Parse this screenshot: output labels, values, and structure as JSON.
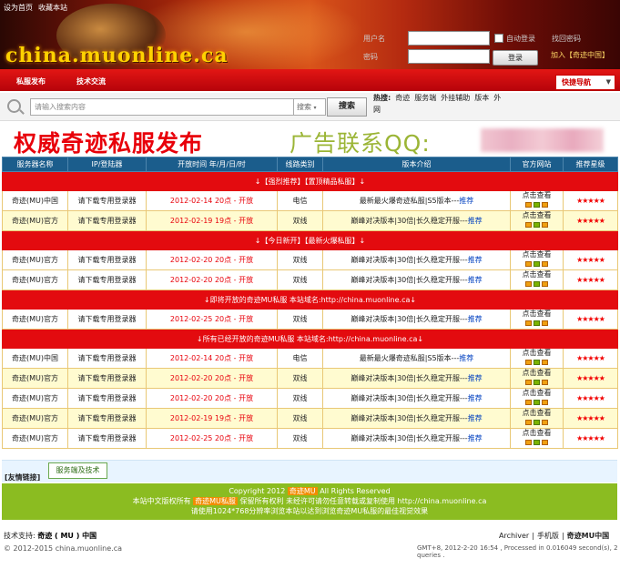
{
  "top_links": [
    "设为首页",
    "收藏本站"
  ],
  "site_logo": "china.muonline.ca",
  "login": {
    "username_label": "用户名",
    "password_label": "密码",
    "auto_login_label": "自动登录",
    "find_password_label": "找回密码",
    "login_button": "登录",
    "join_link": "加入【奇迹中国】"
  },
  "nav": {
    "items": [
      "私服发布",
      "技术交流"
    ],
    "quick_nav": "快捷导航"
  },
  "search": {
    "placeholder": "请输入搜索内容",
    "type_label": "搜索",
    "button": "搜索",
    "hot_label": "热搜:",
    "hot_items": [
      "奇迹",
      "服务端",
      "外挂辅助",
      "版本",
      "外网"
    ]
  },
  "headline": {
    "left": "权威奇迹私服发布",
    "right": "广告联系QQ:"
  },
  "table": {
    "headers": [
      "服务器名称",
      "IP/登陆器",
      "开放时间 年/月/日/时",
      "线路类别",
      "版本介绍",
      "官方网站",
      "推荐星级"
    ],
    "web_label": "点击查看",
    "recommend_link": "推荐",
    "stars": "★★★★★",
    "sections": [
      {
        "title": "↓【强烈推荐】【置顶精品私服】↓",
        "rows": [
          {
            "name": "奇迹(MU)中国",
            "ip": "请下载专用登录器",
            "open": "2012-02-14 20点 - 开放",
            "line": "电信",
            "desc": "最新最火爆奇迹私服|S5版本---"
          },
          {
            "name": "奇迹(MU)官方",
            "ip": "请下载专用登录器",
            "open": "2012-02-19 19点 - 开放",
            "line": "双线",
            "desc": "巅峰对决版本|30倍|长久稳定开服---"
          }
        ]
      },
      {
        "title": "↓【今日新开】【最新火爆私服】↓",
        "rows": [
          {
            "name": "奇迹(MU)官方",
            "ip": "请下载专用登录器",
            "open": "2012-02-20 20点 - 开放",
            "line": "双线",
            "desc": "巅峰对决版本|30倍|长久稳定开服---"
          },
          {
            "name": "奇迹(MU)官方",
            "ip": "请下载专用登录器",
            "open": "2012-02-20 20点 - 开放",
            "line": "双线",
            "desc": "巅峰对决版本|30倍|长久稳定开服---"
          }
        ]
      },
      {
        "title": "↓即将开放的奇迹MU私服 本站域名:http://china.muonline.ca↓",
        "rows": [
          {
            "name": "奇迹(MU)官方",
            "ip": "请下载专用登录器",
            "open": "2012-02-25 20点 - 开放",
            "line": "双线",
            "desc": "巅峰对决版本|30倍|长久稳定开服---"
          }
        ]
      },
      {
        "title": "↓所有已经开放的奇迹MU私服 本站域名:http://china.muonline.ca↓",
        "rows": [
          {
            "name": "奇迹(MU)中国",
            "ip": "请下载专用登录器",
            "open": "2012-02-14 20点 - 开放",
            "line": "电信",
            "desc": "最新最火爆奇迹私服|S5版本---"
          },
          {
            "name": "奇迹(MU)官方",
            "ip": "请下载专用登录器",
            "open": "2012-02-20 20点 - 开放",
            "line": "双线",
            "desc": "巅峰对决版本|30倍|长久稳定开服---"
          },
          {
            "name": "奇迹(MU)官方",
            "ip": "请下载专用登录器",
            "open": "2012-02-20 20点 - 开放",
            "line": "双线",
            "desc": "巅峰对决版本|30倍|长久稳定开服---"
          },
          {
            "name": "奇迹(MU)官方",
            "ip": "请下载专用登录器",
            "open": "2012-02-19 19点 - 开放",
            "line": "双线",
            "desc": "巅峰对决版本|30倍|长久稳定开服---"
          },
          {
            "name": "奇迹(MU)官方",
            "ip": "请下载专用登录器",
            "open": "2012-02-25 20点 - 开放",
            "line": "双线",
            "desc": "巅峰对决版本|30倍|长久稳定开服---"
          }
        ]
      }
    ]
  },
  "friends": {
    "label": "[友情链接]",
    "link": "服务端及技术"
  },
  "footer": {
    "line1_pre": "Copyright 2012",
    "line1_hl": "奇迹MU",
    "line1_post": "All Rights Reserved",
    "line2_pre": "本站中文版权所有",
    "line2_hl": "奇迹MU私服",
    "line2_post": "保留所有权利 未经许可请勿任意转载或复制使用 http://china.muonline.ca",
    "line3": "请使用1024*768分辨率浏览本站以达到浏览奇迹MU私服的最佳视觉效果"
  },
  "bottom": {
    "tech_label": "技术支持:",
    "tech_value": "奇迹 ( MU ) 中国",
    "copyright": "© 2012-2015 china.muonline.ca",
    "links": [
      "Archiver",
      "手机版",
      "奇迹MU中国"
    ],
    "stats": "GMT+8, 2012-2-20 16:54 , Processed in 0.016049 second(s), 2 queries ."
  },
  "colors": {
    "nav_red": "#d40c10",
    "section_red": "#e30b0f",
    "header_blue": "#1b5d8c",
    "footer_green": "#8bbc21",
    "headline_red": "#e8000a",
    "headline_green": "#9bb536"
  }
}
